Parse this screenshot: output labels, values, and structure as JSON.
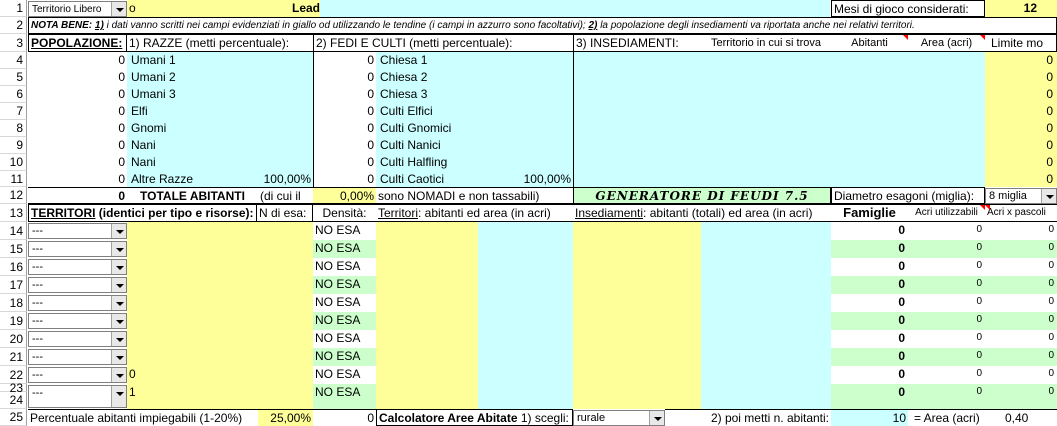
{
  "row_numbers": [
    "1",
    "2",
    "3",
    "4",
    "5",
    "6",
    "7",
    "8",
    "9",
    "10",
    "11",
    "12",
    "13",
    "14",
    "15",
    "16",
    "17",
    "18",
    "19",
    "20",
    "21",
    "22",
    "23",
    "24",
    "25"
  ],
  "header": {
    "territory_select": "Territorio Libero",
    "name_fragment": "o",
    "leader_label": "Leader:",
    "months_label": "Mesi di gioco considerati:",
    "months_value": "12"
  },
  "note": {
    "bold_label": "NOTA BENE:",
    "n1": "1)",
    "text1": "i dati vanno scritti nei campi evidenziati in giallo od utilizzando le tendine (i campi in azzurro sono facoltativi);",
    "n2": "2)",
    "text2": "la popolazione degli insediamenti va riportata anche nei relativi territori."
  },
  "sections": {
    "population_title": "POPOLAZIONE:",
    "races_title": "1) RAZZE (metti percentuale):",
    "faith_title": "2) FEDI E CULTI (metti percentuale):",
    "settlements_title": "3) INSEDIAMENTI:",
    "territory_col": "Territorio in cui si trova",
    "inhabitants_col": "Abitanti",
    "area_col": "Area (acri)",
    "limit_col": "Limite mo"
  },
  "races": [
    {
      "count": "0",
      "name": "Umani 1",
      "pct": ""
    },
    {
      "count": "0",
      "name": "Umani 2",
      "pct": ""
    },
    {
      "count": "0",
      "name": "Umani 3",
      "pct": ""
    },
    {
      "count": "0",
      "name": "Elfi",
      "pct": ""
    },
    {
      "count": "0",
      "name": "Gnomi",
      "pct": ""
    },
    {
      "count": "0",
      "name": "Nani",
      "pct": ""
    },
    {
      "count": "0",
      "name": "Nani",
      "pct": ""
    },
    {
      "count": "0",
      "name": "Altre Razze",
      "pct": "100,00%"
    }
  ],
  "faiths": [
    {
      "count": "0",
      "name": "Chiesa 1",
      "pct": ""
    },
    {
      "count": "0",
      "name": "Chiesa 2",
      "pct": ""
    },
    {
      "count": "0",
      "name": "Chiesa 3",
      "pct": ""
    },
    {
      "count": "0",
      "name": "Culti Elfici",
      "pct": ""
    },
    {
      "count": "0",
      "name": "Culti Gnomici",
      "pct": ""
    },
    {
      "count": "0",
      "name": "Culti Nanici",
      "pct": ""
    },
    {
      "count": "0",
      "name": "Culti Halfling",
      "pct": ""
    },
    {
      "count": "0",
      "name": "Culti Caotici",
      "pct": "100,00%"
    }
  ],
  "settlement_limits": [
    "0",
    "0",
    "0",
    "0",
    "0",
    "0",
    "0",
    "0"
  ],
  "totals": {
    "total_value": "0",
    "total_label": "TOTALE ABITANTI",
    "of_which": "(di cui il",
    "nomad_pct": "0,00%",
    "nomad_text": "sono NOMADI e non tassabili)",
    "generator_title": "GENERATORE DI FEUDI 7.5",
    "hex_label": "Diametro esagoni (miglia):",
    "hex_value": "8 miglia"
  },
  "territory_header": {
    "title_u": "TERRITORI",
    "title_rest": " (identici per tipo e risorse):",
    "n_esa": "N di esa:",
    "density": "Densità:",
    "terr_u": "Territori",
    "terr_rest": ": abitanti ed area (in acri)",
    "ins_u": "Insediamenti",
    "ins_rest": ": abitanti (totali) ed area (in acri)",
    "families": "Famiglie",
    "acres_usable": "Acri utilizzabili",
    "acres_pasture": "Acri x pascoli"
  },
  "territory_rows": [
    {
      "select": "---",
      "n": "",
      "density": "NO ESA",
      "families": "0",
      "acres": "0",
      "pasture": "0"
    },
    {
      "select": "---",
      "n": "",
      "density": "NO ESA",
      "families": "0",
      "acres": "0",
      "pasture": "0"
    },
    {
      "select": "---",
      "n": "",
      "density": "NO ESA",
      "families": "0",
      "acres": "0",
      "pasture": "0"
    },
    {
      "select": "---",
      "n": "",
      "density": "NO ESA",
      "families": "0",
      "acres": "0",
      "pasture": "0"
    },
    {
      "select": "---",
      "n": "",
      "density": "NO ESA",
      "families": "0",
      "acres": "0",
      "pasture": "0"
    },
    {
      "select": "---",
      "n": "",
      "density": "NO ESA",
      "families": "0",
      "acres": "0",
      "pasture": "0"
    },
    {
      "select": "---",
      "n": "",
      "density": "NO ESA",
      "families": "0",
      "acres": "0",
      "pasture": "0"
    },
    {
      "select": "---",
      "n": "",
      "density": "NO ESA",
      "families": "0",
      "acres": "0",
      "pasture": "0"
    },
    {
      "select": "---",
      "n": "0",
      "density": "NO ESA",
      "families": "0",
      "acres": "0",
      "pasture": "0"
    },
    {
      "select": "---",
      "n": "1",
      "density": "NO ESA",
      "families": "0",
      "acres": "0",
      "pasture": "0"
    }
  ],
  "footer": {
    "unemployable_label": "Percentuale abitanti impiegabili (1-20%)",
    "unemployable_pct": "25,00%",
    "unemployable_value": "0",
    "calc_label": "Calcolatore Aree Abitate",
    "calc_step1": "1) scegli:",
    "calc_select": "rurale",
    "calc_step2": "2) poi metti n. abitanti:",
    "calc_inhabitants": "10",
    "calc_eq": "= Area (acri)",
    "calc_area": "0,40"
  },
  "colors": {
    "input_yellow": "#ffff99",
    "optional_cyan": "#ccffff",
    "row_green": "#ccffcc",
    "comment_red": "#ff0000"
  }
}
